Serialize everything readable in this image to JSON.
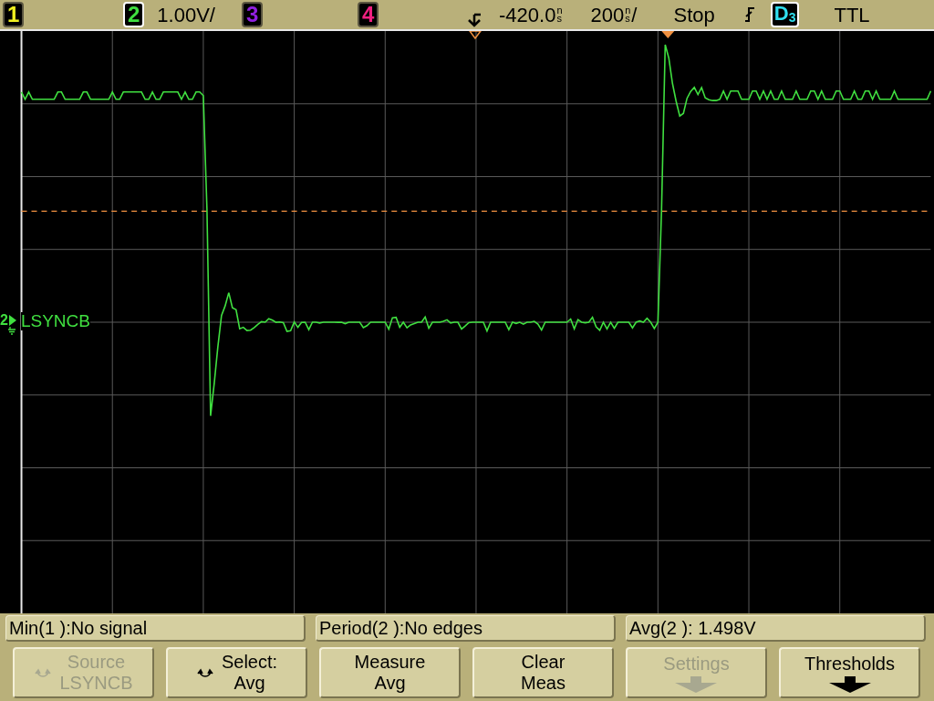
{
  "status_bar": {
    "channels": [
      {
        "number": "1",
        "color": "#f0f020",
        "on": false
      },
      {
        "number": "2",
        "color": "#40e040",
        "on": true,
        "scale": "1.00V/"
      },
      {
        "number": "3",
        "color": "#9020e0",
        "on": false
      },
      {
        "number": "4",
        "color": "#f02080",
        "on": false
      }
    ],
    "delay": {
      "value": "-420.0",
      "unit_top": "n",
      "unit_bottom": "s"
    },
    "timebase": {
      "value": "200",
      "unit_top": "n",
      "unit_bottom": "s",
      "suffix": "/"
    },
    "run_state": "Stop",
    "trigger_source": {
      "letter": "D",
      "index": "3",
      "color": "#30e0f0"
    },
    "trigger_type": "TTL"
  },
  "display": {
    "trace_label": {
      "channel": "2",
      "name": "LSYNCB",
      "color": "#40e040"
    }
  },
  "measurements": [
    {
      "text": "Min(1 ):No signal"
    },
    {
      "text": "Period(2 ):No edges"
    },
    {
      "text": "Avg(2 ): 1.498V"
    }
  ],
  "softkeys": [
    {
      "kind": "knob",
      "line1": "Source",
      "line2": "LSYNCB",
      "disabled": true
    },
    {
      "kind": "knob",
      "line1": "Select:",
      "line2": "Avg",
      "disabled": false
    },
    {
      "kind": "text",
      "line1": "Measure",
      "line2": "Avg",
      "disabled": false
    },
    {
      "kind": "text",
      "line1": "Clear",
      "line2": "Meas",
      "disabled": false
    },
    {
      "kind": "menu",
      "line1": "Settings",
      "disabled": true
    },
    {
      "kind": "menu",
      "line1": "Thresholds",
      "disabled": false
    }
  ]
}
